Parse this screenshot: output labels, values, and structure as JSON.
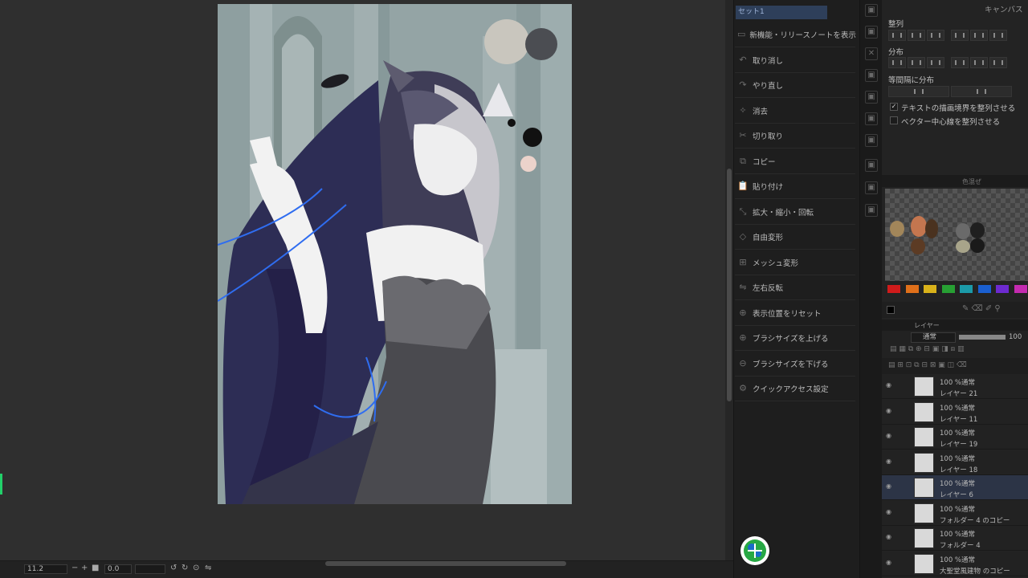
{
  "canvas": {
    "zoom": "11.2",
    "rotation": "0.0"
  },
  "quick_access": {
    "panel_title": "セット1",
    "items": [
      {
        "label": "新機能・リリースノートを表示",
        "icon": "news-icon"
      },
      {
        "label": "取り消し",
        "icon": "undo-icon"
      },
      {
        "label": "やり直し",
        "icon": "redo-icon"
      },
      {
        "label": "消去",
        "icon": "clear-icon"
      },
      {
        "label": "切り取り",
        "icon": "cut-icon"
      },
      {
        "label": "コピー",
        "icon": "copy-icon"
      },
      {
        "label": "貼り付け",
        "icon": "paste-icon"
      },
      {
        "label": "拡大・縮小・回転",
        "icon": "scale-rotate-icon"
      },
      {
        "label": "自由変形",
        "icon": "free-transform-icon"
      },
      {
        "label": "メッシュ変形",
        "icon": "mesh-transform-icon"
      },
      {
        "label": "左右反転",
        "icon": "flip-horizontal-icon"
      },
      {
        "label": "表示位置をリセット",
        "icon": "reset-view-icon"
      },
      {
        "label": "ブラシサイズを上げる",
        "icon": "brush-size-up-icon"
      },
      {
        "label": "ブラシサイズを下げる",
        "icon": "brush-size-down-icon"
      },
      {
        "label": "クイックアクセス設定",
        "icon": "settings-icon"
      }
    ]
  },
  "object_panel": {
    "tab_label": "キャンバス",
    "align_label": "整列",
    "distribute_label": "分布",
    "equal_spacing_label": "等間隔に分布",
    "checkbox_text_bounds": "テキストの描画境界を整列させる",
    "checkbox_text_bounds_checked": true,
    "checkbox_vector_center": "ベクター中心線を整列させる",
    "checkbox_vector_center_checked": false
  },
  "palette": {
    "tab_label": "色混ぜ",
    "color_bar": [
      "#d01b1b",
      "#e0701a",
      "#d9b21a",
      "#27a033",
      "#1b9aa8",
      "#1a5fd0",
      "#6d2ad0",
      "#c42bb0"
    ]
  },
  "layer_panel": {
    "tab_label": "レイヤー",
    "blend_mode": "通常",
    "opacity": "100",
    "layers": [
      {
        "mode": "100 %通常",
        "name": "レイヤー 21",
        "selected": false
      },
      {
        "mode": "100 %通常",
        "name": "レイヤー 11",
        "selected": false
      },
      {
        "mode": "100 %通常",
        "name": "レイヤー 19",
        "selected": false
      },
      {
        "mode": "100 %通常",
        "name": "レイヤー 18",
        "selected": false
      },
      {
        "mode": "100 %通常",
        "name": "レイヤー 6",
        "selected": true
      },
      {
        "mode": "100 %通常",
        "name": "フォルダー 4 のコピー",
        "selected": false
      },
      {
        "mode": "100 %通常",
        "name": "フォルダー 4",
        "selected": false
      },
      {
        "mode": "100 %通常",
        "name": "大聖堂風建物 のコピー",
        "selected": false
      }
    ]
  }
}
